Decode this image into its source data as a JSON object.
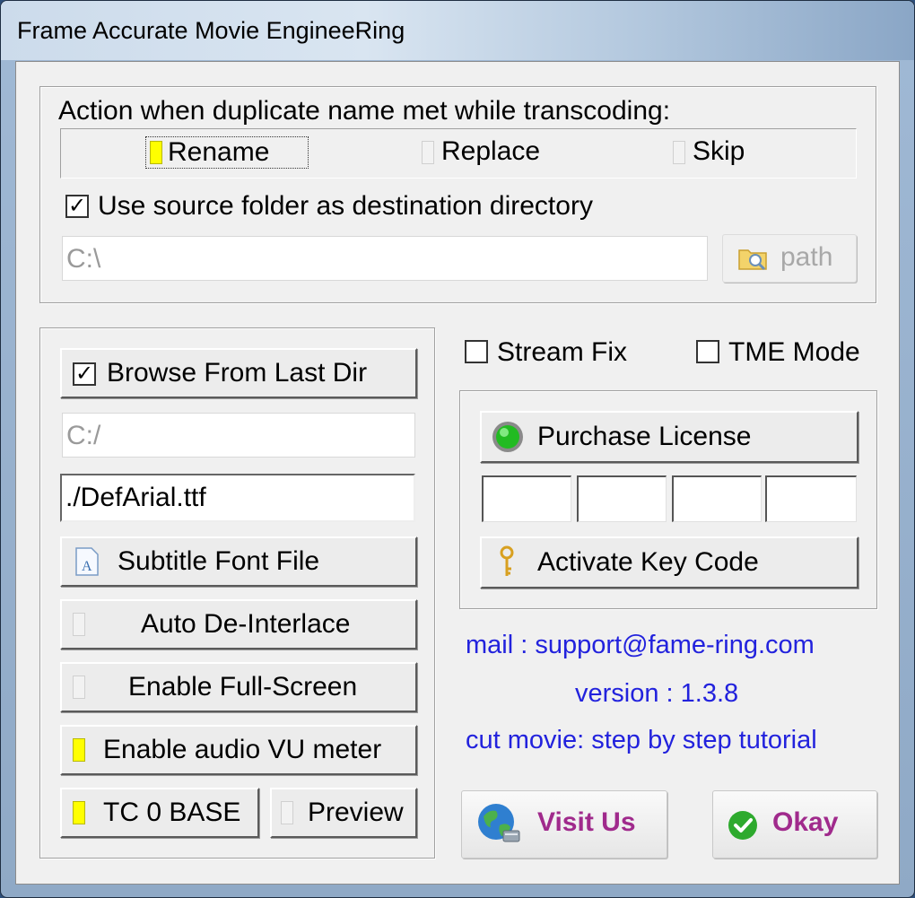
{
  "window": {
    "title": "Frame Accurate Movie EngineeRing"
  },
  "duplicate": {
    "heading": "Action when duplicate name met while transcoding:",
    "options": [
      {
        "label": "Rename",
        "selected": true
      },
      {
        "label": "Replace",
        "selected": false
      },
      {
        "label": "Skip",
        "selected": false
      }
    ],
    "use_source_label": "Use source folder as destination directory",
    "use_source_checked": true,
    "dest_path": "C:\\",
    "path_button": "path"
  },
  "left": {
    "browse_label": "Browse From Last Dir",
    "browse_checked": true,
    "browse_path": "C:/",
    "font_file": "./DefArial.ttf",
    "subtitle_font_button": "Subtitle Font File",
    "auto_deinterlace": {
      "label": "Auto De-Interlace",
      "on": false
    },
    "full_screen": {
      "label": "Enable Full-Screen",
      "on": false
    },
    "vu_meter": {
      "label": "Enable audio VU meter",
      "on": true
    },
    "tc_base": {
      "label": "TC 0 BASE",
      "on": true
    },
    "preview": {
      "label": "Preview",
      "on": false
    }
  },
  "right": {
    "stream_fix": {
      "label": "Stream Fix",
      "checked": false
    },
    "tme_mode": {
      "label": "TME Mode",
      "checked": false
    },
    "purchase_label": "Purchase License",
    "key_fields": [
      "",
      "",
      "",
      ""
    ],
    "activate_label": "Activate Key Code",
    "mail": "mail : support@fame-ring.com",
    "version": "version : 1.3.8",
    "tutorial": "cut movie: step by step tutorial",
    "visit_label": "Visit Us",
    "okay_label": "Okay"
  },
  "colors": {
    "link": "#2222dd",
    "accent_purple": "#a02a8c",
    "led_on": "#ffff00",
    "led_green": "#22bb22"
  }
}
